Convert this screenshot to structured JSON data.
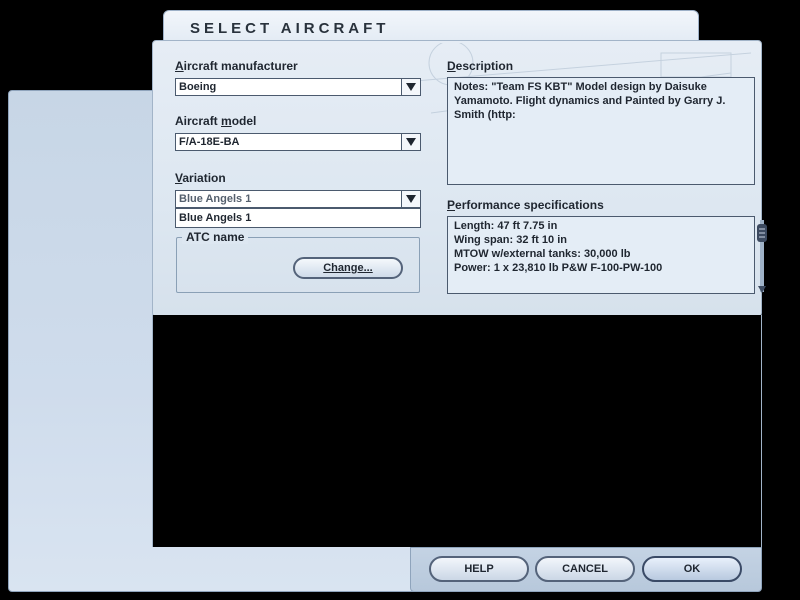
{
  "title": "SELECT AIRCRAFT",
  "manufacturer": {
    "label_prefix": "A",
    "label_rest": "ircraft manufacturer",
    "value": "Boeing"
  },
  "model": {
    "label_prefix": "Aircraft ",
    "label_u": "m",
    "label_rest": "odel",
    "value": "F/A-18E-BA"
  },
  "variation": {
    "label_prefix": "V",
    "label_rest": "ariation",
    "value": "Blue Angels 1",
    "options": [
      "Blue Angels 1"
    ]
  },
  "atc": {
    "legend": "ATC name",
    "change_label": "Change..."
  },
  "description": {
    "label_prefix": "D",
    "label_rest": "escription",
    "text": "Notes: \"Team FS KBT\" Model design by Daisuke Yamamoto. Flight dynamics and Painted by Garry J. Smith (http:"
  },
  "performance": {
    "label_prefix": "P",
    "label_rest": "erformance specifications",
    "lines": [
      "Length: 47 ft 7.75 in",
      "Wing span: 32 ft 10 in",
      "MTOW w/external tanks: 30,000 lb",
      "Power: 1 x 23,810 lb P&W F-100-PW-100"
    ]
  },
  "buttons": {
    "help": "HELP",
    "cancel": "CANCEL",
    "ok": "OK"
  },
  "icons": {
    "dropdown": "chevron-down-icon"
  }
}
